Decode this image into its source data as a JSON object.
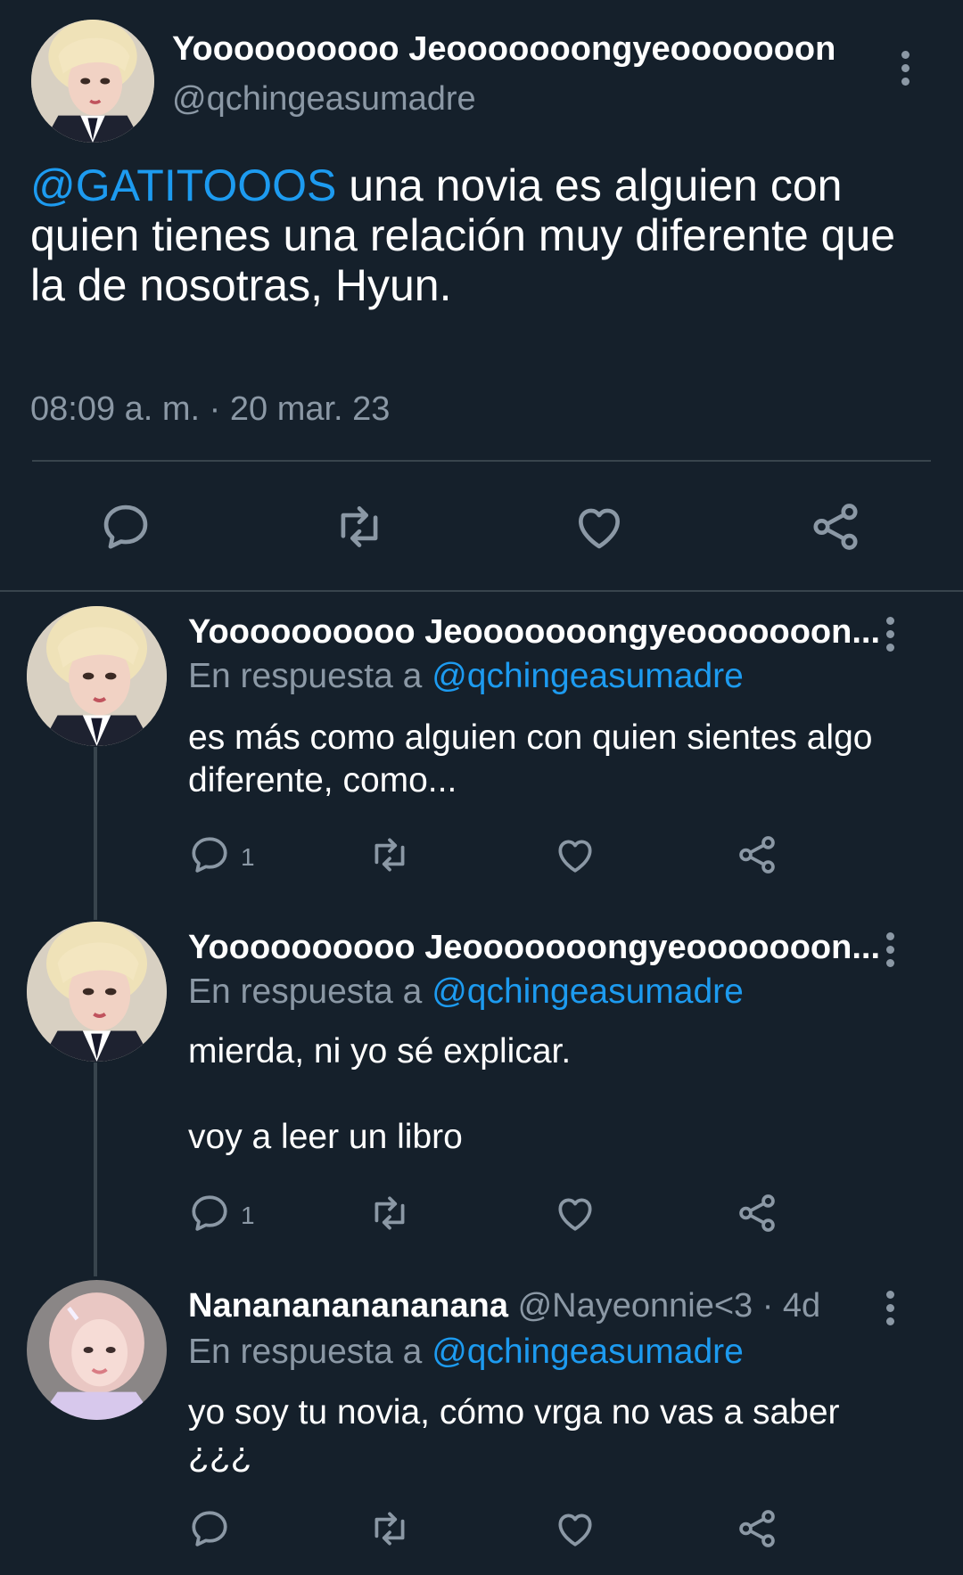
{
  "main_tweet": {
    "display_name": "Yoooooooooo Jeooooooongyeooooooon",
    "handle": "@qchingeasumadre",
    "mention": "@GATITOOOS",
    "text": " una novia es alguien con quien tienes una relación muy diferente que la de nosotras, Hyun.",
    "timestamp": "08:09 a. m. · 20 mar. 23"
  },
  "replies": [
    {
      "display_name": "Yoooooooooo Jeooooooongyeooooooon...",
      "reply_prefix": "En respuesta a",
      "reply_to": "@qchingeasumadre",
      "text": "es más como alguien con quien sientes algo diferente, como...",
      "reply_count": "1"
    },
    {
      "display_name": "Yoooooooooo Jeooooooongyeooooooon...",
      "reply_prefix": "En respuesta a",
      "reply_to": "@qchingeasumadre",
      "text_line1": "mierda, ni yo sé explicar.",
      "text_line2": "voy a leer un libro",
      "reply_count": "1"
    },
    {
      "display_name": "Nananananananana",
      "handle": "@Nayeonnie<3 · 4d",
      "reply_prefix": "En respuesta a",
      "reply_to": "@qchingeasumadre",
      "text": "yo soy tu novia, cómo vrga no vas a saber ¿¿¿"
    }
  ],
  "icons": {
    "reply": "reply-icon",
    "retweet": "retweet-icon",
    "like": "like-icon",
    "share": "share-icon",
    "more": "more-icon"
  },
  "colors": {
    "background": "#15202b",
    "link": "#1d9bf0",
    "secondary_text": "#8b98a5",
    "divider": "#38444d"
  }
}
